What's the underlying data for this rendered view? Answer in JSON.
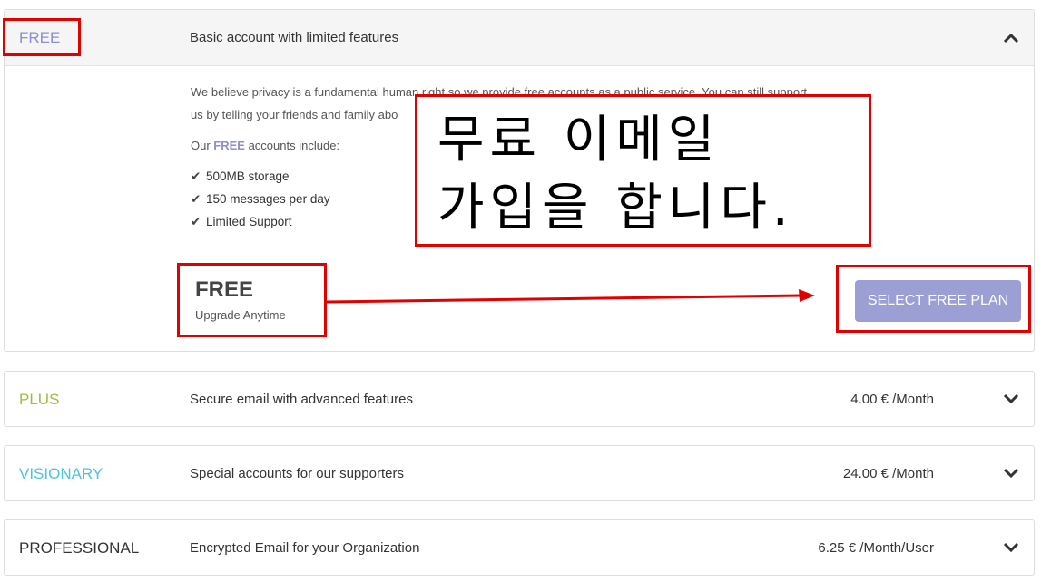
{
  "free": {
    "name": "FREE",
    "description": "Basic account with limited features",
    "intro": "We believe privacy is a fundamental human right so we provide free accounts as a public service. You can still support",
    "intro2": "us by telling your friends and family abo",
    "include_prefix": "Our ",
    "include_highlight": "FREE",
    "include_suffix": " accounts include:",
    "features": [
      "500MB storage",
      "150 messages per day",
      "Limited Support"
    ],
    "price": "FREE",
    "price_note": "Upgrade Anytime",
    "button": "SELECT FREE PLAN"
  },
  "annotation": {
    "line1": "무료 이메일",
    "line2": "가입을 합니다."
  },
  "plans": [
    {
      "name": "PLUS",
      "description": "Secure email with advanced features",
      "price": "4.00 € /Month",
      "color": "#9cbf3b"
    },
    {
      "name": "VISIONARY",
      "description": "Special accounts for our supporters",
      "price": "24.00 € /Month",
      "color": "#4fc3dd"
    },
    {
      "name": "PROFESSIONAL",
      "description": "Encrypted Email for your Organization",
      "price": "6.25 € /Month/User",
      "color": "#333333"
    }
  ],
  "colors": {
    "free_accent": "#8b8fd0",
    "button": "#9b9fd4",
    "annotation": "#e00000"
  }
}
